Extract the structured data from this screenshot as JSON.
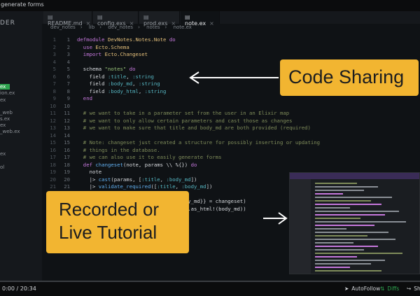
{
  "window": {
    "title": "generate forms"
  },
  "sidebar": {
    "heading": "DER",
    "items": [
      {
        "label": "ex",
        "active": true
      },
      {
        "label": "ion.ex",
        "active": false
      },
      {
        "label": "ex",
        "active": false
      },
      {
        "label": "_web",
        "active": false
      },
      {
        "label": "s.ex",
        "active": false
      },
      {
        "label": "ex",
        "active": false
      },
      {
        "label": "_web.ex",
        "active": false
      },
      {
        "label": "ex",
        "active": false
      },
      {
        "label": "ol",
        "active": false
      }
    ]
  },
  "tabs": [
    {
      "label": "README.md",
      "icon": "file-icon",
      "active": false
    },
    {
      "label": "config.exs",
      "icon": "file-icon",
      "active": false
    },
    {
      "label": "prod.exs",
      "icon": "file-icon",
      "active": false
    },
    {
      "label": "note.ex",
      "icon": "file-icon",
      "active": true
    }
  ],
  "breadcrumb": [
    "dev_notes",
    "lib",
    "dev_notes",
    "notes",
    "note.ex"
  ],
  "code_lines": [
    {
      "n1": "1",
      "n2": "1",
      "html": "<span class='kw'>defmodule</span> <span class='md'>DevNotes.Notes.Note</span> <span class='kw'>do</span>"
    },
    {
      "n1": "2",
      "n2": "2",
      "html": "  <span class='kw'>use</span> <span class='md'>Ecto.Schema</span>"
    },
    {
      "n1": "3",
      "n2": "3",
      "html": "  <span class='kw'>import</span> <span class='md'>Ecto.Changeset</span>"
    },
    {
      "n1": "4",
      "n2": "4",
      "html": ""
    },
    {
      "n1": "5",
      "n2": "5",
      "html": "  schema <span class='str'>\"notes\"</span> <span class='kw'>do</span>"
    },
    {
      "n1": "6",
      "n2": "6",
      "html": "    field <span class='at'>:title</span>, <span class='at'>:string</span>"
    },
    {
      "n1": "7",
      "n2": "7",
      "html": "    field <span class='at'>:body_md</span>, <span class='at'>:string</span>"
    },
    {
      "n1": "8",
      "n2": "8",
      "html": "    field <span class='at'>:body_html</span>, <span class='at'>:string</span>"
    },
    {
      "n1": "9",
      "n2": "9",
      "html": "  <span class='kw'>end</span>"
    },
    {
      "n1": "10",
      "n2": "10",
      "html": ""
    },
    {
      "n1": "11",
      "n2": "11",
      "html": "  <span class='cm'># we want to take in a parameter set from the user in an Elixir map</span>"
    },
    {
      "n1": "12",
      "n2": "12",
      "html": "  <span class='cm'># we want to only allow certain parameters and cast those as changes</span>"
    },
    {
      "n1": "13",
      "n2": "13",
      "html": "  <span class='cm'># we want to make sure that title and body_md are both provided (required)</span>"
    },
    {
      "n1": "14",
      "n2": "14",
      "html": ""
    },
    {
      "n1": "15",
      "n2": "15",
      "html": "  <span class='cm'># Note: changeset just created a structure for possibly inserting or updating</span>"
    },
    {
      "n1": "16",
      "n2": "16",
      "html": "  <span class='cm'># things in the database.</span>"
    },
    {
      "n1": "17",
      "n2": "17",
      "html": "  <span class='cm'># we can also use it to easily generate forms</span>"
    },
    {
      "n1": "18",
      "n2": "18",
      "html": "  <span class='kw'>def</span> <span class='fn'>changeset</span>(note, params \\\\ %{}) <span class='kw'>do</span>"
    },
    {
      "n1": "19",
      "n2": "19",
      "html": "    note"
    },
    {
      "n1": "20",
      "n2": "20",
      "html": "    |> <span class='fn'>cast</span>(params, [<span class='at'>:title</span>, <span class='at'>:body_md</span>])"
    },
    {
      "n1": "21",
      "n2": "21",
      "html": "    |> <span class='fn'>validate_required</span>([<span class='at'>:title</span>, <span class='at'>:body_md</span>])"
    },
    {
      "n1": "",
      "n2": "",
      "html": ""
    },
    {
      "n1": "",
      "n2": "",
      "html": "                             <span class='fn'>md</span>: body_md}} = changeset)"
    },
    {
      "n1": "",
      "n2": "",
      "html": "                             <span class='md'>Earmark</span>.as_html!(body_md))"
    },
    {
      "n1": "",
      "n2": "",
      "html": ""
    },
    {
      "n1": "",
      "n2": "",
      "html": "                   changeset"
    },
    {
      "n1": "",
      "n2": "",
      "html": ""
    },
    {
      "n1": "",
      "n2": "30",
      "html": ""
    }
  ],
  "callouts": {
    "code_sharing": "Code Sharing",
    "tutorial_line1": "Recorded or",
    "tutorial_line2": "Live Tutorial"
  },
  "player": {
    "time": "0:00 / 20:34",
    "progress_percent": 0,
    "controls": [
      {
        "label": "AutoFollow",
        "icon": "navigation-icon",
        "active": false
      },
      {
        "label": "Diffs",
        "icon": "diff-icon",
        "active": true
      },
      {
        "label": "Sh",
        "icon": "share-icon",
        "active": false
      }
    ]
  },
  "colors": {
    "accent": "#f2b531",
    "active_green": "#2ea44f",
    "editor_bg": "#0f1215"
  }
}
